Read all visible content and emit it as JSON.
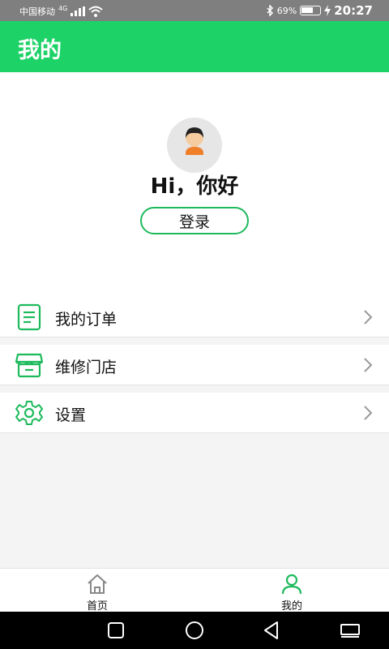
{
  "status_bar": {
    "carrier": "中国移动",
    "network": "4G",
    "battery_percent": "69%",
    "time": "20:27"
  },
  "header": {
    "title": "我的"
  },
  "profile": {
    "greeting": "Hi，你好",
    "login_label": "登录"
  },
  "menu": [
    {
      "label": "我的订单",
      "icon": "order-list-icon"
    },
    {
      "label": "维修门店",
      "icon": "store-icon"
    },
    {
      "label": "设置",
      "icon": "gear-icon"
    }
  ],
  "bottom_nav": {
    "tabs": [
      {
        "label": "首页",
        "icon": "home-icon",
        "active": false
      },
      {
        "label": "我的",
        "icon": "user-icon",
        "active": true
      }
    ]
  },
  "colors": {
    "accent": "#1dd267",
    "icon_green": "#1dba5c",
    "status_bar": "#7f7f7f"
  }
}
